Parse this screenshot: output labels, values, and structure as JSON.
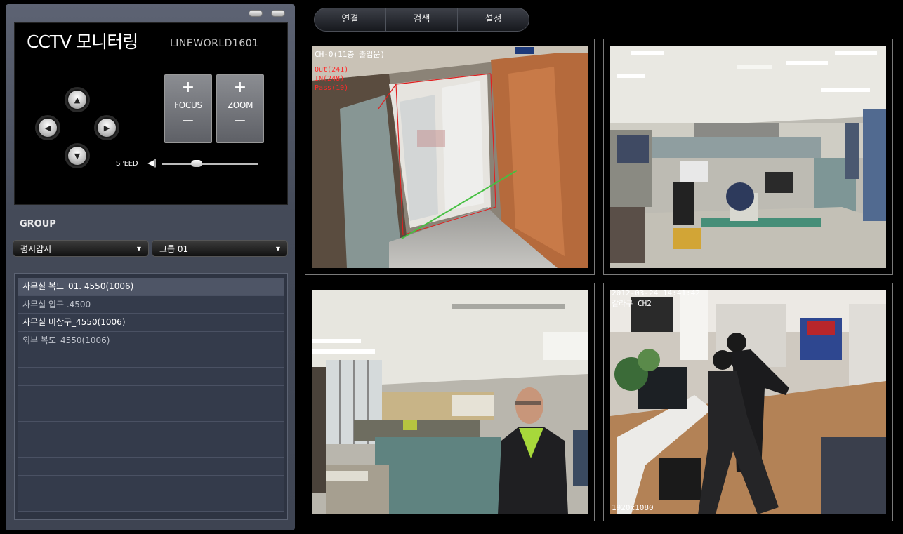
{
  "app": {
    "title": "CCTV 모니터링",
    "subtitle": "LINEWORLD1601"
  },
  "menu": {
    "items": [
      "연결",
      "검색",
      "설정"
    ]
  },
  "ptz": {
    "focus_label": "FOCUS",
    "zoom_label": "ZOOM",
    "plus": "+",
    "minus": "−",
    "speed_label": "SPEED",
    "speed_level": 0.35
  },
  "group": {
    "label": "GROUP",
    "mode_value": "평시감시",
    "group_value": "그룹 01"
  },
  "camera_list": [
    "사무실 복도_01. 4550(1006)",
    "사무실 입구 .4500",
    "사무실 비상구_4550(1006)",
    "외부 복도_4550(1006)"
  ],
  "cameras": {
    "cam1": {
      "channel": "CH-0(11층 출입문)",
      "out_count": "Out(241)",
      "in_count": "IN(248)",
      "pass_count": "Pass(10)"
    },
    "cam4": {
      "timestamp": "2012-03-24 14:41:42",
      "channel": "갈라쿠 CH2",
      "resolution": "1920x1080"
    }
  }
}
